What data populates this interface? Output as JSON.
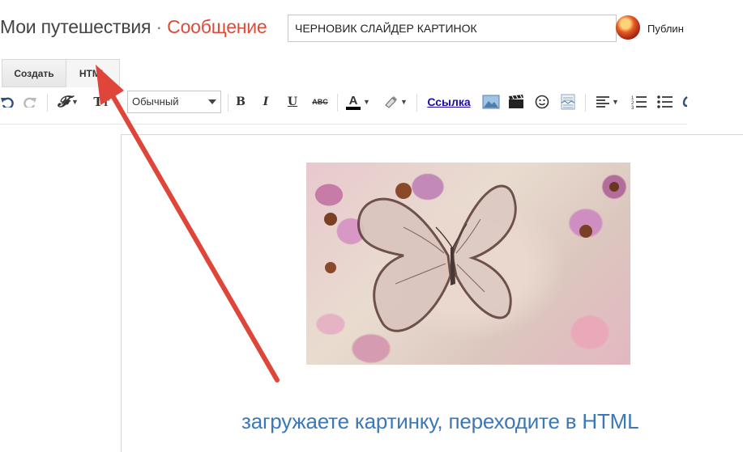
{
  "header": {
    "blog_name": "Мои путешествия",
    "separator": "·",
    "post_label": "Сообщение",
    "post_title": "ЧЕРНОВИК СЛАЙДЕР КАРТИНОК",
    "publish_label": "Публин"
  },
  "mode_tabs": [
    {
      "label": "Создать",
      "selected": true
    },
    {
      "label": "HTML",
      "selected": false
    }
  ],
  "toolbar": {
    "format_value": "Обычный",
    "bold": "B",
    "italic": "I",
    "underline": "U",
    "strike": "ABC",
    "link": "Ссылка"
  },
  "annotation": {
    "caption": "загружаете картинку, переходите в HTML",
    "arrow_color": "#e0453a",
    "caption_color": "#3b78b8"
  },
  "colors": {
    "post_label": "#dd4b39",
    "link": "#1a0dab"
  }
}
